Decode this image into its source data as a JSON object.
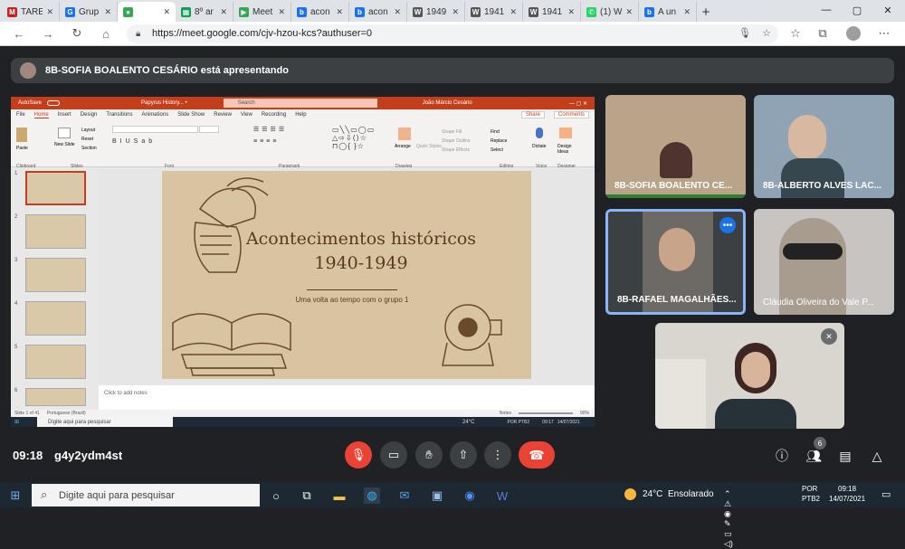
{
  "browser": {
    "tabs": [
      {
        "title": "TARE",
        "color": "#c5221f",
        "glyph": "M"
      },
      {
        "title": "Grup",
        "color": "#1a73e8",
        "glyph": "G"
      },
      {
        "title": "",
        "color": "#34a853",
        "glyph": "●",
        "active": true
      },
      {
        "title": "8º ar",
        "color": "#0f9d58",
        "glyph": "▦"
      },
      {
        "title": "Meet",
        "color": "#34a853",
        "glyph": "▶"
      },
      {
        "title": "acon",
        "color": "#1a73e8",
        "glyph": "b"
      },
      {
        "title": "acon",
        "color": "#1a73e8",
        "glyph": "b"
      },
      {
        "title": "1949",
        "color": "#555555",
        "glyph": "W"
      },
      {
        "title": "1941",
        "color": "#555555",
        "glyph": "W"
      },
      {
        "title": "1941",
        "color": "#555555",
        "glyph": "W"
      },
      {
        "title": "(1) W",
        "color": "#25d366",
        "glyph": "✆"
      },
      {
        "title": "A un",
        "color": "#1a73e8",
        "glyph": "b"
      }
    ],
    "url": "https://meet.google.com/cjv-hzou-kcs?authuser=0"
  },
  "presenter_banner": "8B-SOFIA BOALENTO CESÁRIO está apresentando",
  "presentation": {
    "window_title": "Papyrus History... •",
    "search": "Search",
    "user": "João Márcio Cesário",
    "autosave": "AutoSave",
    "menu": [
      "File",
      "Home",
      "Insert",
      "Design",
      "Transitions",
      "Animations",
      "Slide Show",
      "Review",
      "View",
      "Recording",
      "Help"
    ],
    "share": "Share",
    "comments": "Comments",
    "ribbon_groups": [
      "Clipboard",
      "Slides",
      "Font",
      "Paragraph",
      "Drawing",
      "Editing",
      "Voice",
      "Designer"
    ],
    "ribbon_items": {
      "paste": "Paste",
      "new_slide": "New Slide",
      "layout": "Layout",
      "reset": "Reset",
      "section": "Section",
      "arrange": "Arrange",
      "quick_styles": "Quick Styles",
      "shape_fill": "Shape Fill",
      "shape_outline": "Shape Outline",
      "shape_effects": "Shape Effects",
      "find": "Find",
      "replace": "Replace",
      "select": "Select",
      "dictate": "Dictate",
      "design_ideas": "Design Ideas"
    },
    "slide_title": "Acontecimentos históricos 1940-1949",
    "slide_subtitle": "Uma volta ao tempo com o grupo 1",
    "notes": "Click to add notes",
    "thumb_numbers": [
      "1",
      "2",
      "3",
      "4",
      "5",
      "6"
    ],
    "status": {
      "slide": "Slide 1 of 41",
      "lang": "Portuguese (Brazil)",
      "notes": "Notes",
      "zoom": "90%"
    },
    "inner_taskbar": {
      "search": "Digite aqui para pesquisar",
      "weather": "24°C",
      "lang": "POR PTB2",
      "time": "09:17",
      "date": "14/07/2021"
    }
  },
  "participants": [
    {
      "name": "8B-SOFIA BOALENTO CE...",
      "bg": "#b9a48a"
    },
    {
      "name": "8B-ALBERTO ALVES LAC...",
      "bg": "#8fa3b5"
    },
    {
      "name": "8B-RAFAEL MAGALHÃES...",
      "bg": "#6d6a66",
      "highlight": true
    },
    {
      "name": "Cláudia Oliveira do Vale P...",
      "bg": "#c8c4c2"
    },
    {
      "name": "",
      "bg": "#d9d6d0",
      "muted": true
    }
  ],
  "meet": {
    "time": "09:18",
    "code": "g4y2ydm4st",
    "people_count": "6"
  },
  "taskbar": {
    "search": "Digite aqui para pesquisar",
    "weather_temp": "24°C",
    "weather_text": "Ensolarado",
    "lang1": "POR",
    "lang2": "PTB2",
    "time": "09:18",
    "date": "14/07/2021"
  }
}
